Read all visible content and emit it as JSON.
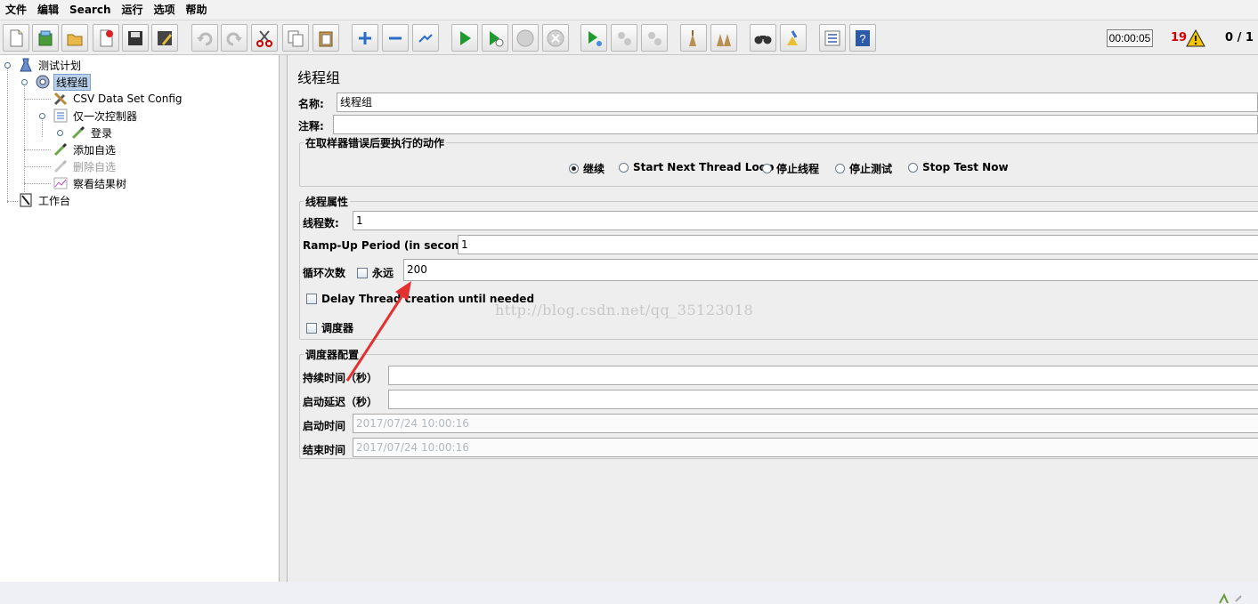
{
  "menu": [
    "文件",
    "编辑",
    "Search",
    "运行",
    "选项",
    "帮助"
  ],
  "toolbar": {
    "buttons": [
      {
        "name": "new-icon"
      },
      {
        "name": "templates-icon"
      },
      {
        "name": "open-icon"
      },
      {
        "name": "close-icon"
      },
      {
        "name": "save-icon"
      },
      {
        "name": "save-as-icon"
      },
      {
        "name": "undo-icon"
      },
      {
        "name": "redo-icon"
      },
      {
        "name": "cut-icon"
      },
      {
        "name": "copy-icon"
      },
      {
        "name": "paste-icon"
      },
      {
        "name": "expand-icon"
      },
      {
        "name": "collapse-icon"
      },
      {
        "name": "toggle-icon"
      },
      {
        "name": "start-icon"
      },
      {
        "name": "start-no-timers-icon"
      },
      {
        "name": "stop-icon"
      },
      {
        "name": "shutdown-icon"
      },
      {
        "name": "remote-start-icon"
      },
      {
        "name": "remote-stop-icon"
      },
      {
        "name": "remote-shutdown-icon"
      },
      {
        "name": "clear-icon"
      },
      {
        "name": "clear-all-icon"
      },
      {
        "name": "search-icon"
      },
      {
        "name": "reset-search-icon"
      },
      {
        "name": "function-helper-icon"
      },
      {
        "name": "help-icon"
      }
    ],
    "timer": "00:00:05",
    "error_count": "19",
    "thread_count": "0 / 1"
  },
  "tree": {
    "items": [
      {
        "label": "测试计划",
        "icon": "test-plan-icon"
      },
      {
        "label": "线程组",
        "icon": "thread-group-icon"
      },
      {
        "label": "CSV Data Set Config",
        "icon": "config-tools-icon"
      },
      {
        "label": "仅一次控制器",
        "icon": "controller-icon"
      },
      {
        "label": "登录",
        "icon": "sampler-pipette-icon"
      },
      {
        "label": "添加自选",
        "icon": "sampler-pipette-icon"
      },
      {
        "label": "删除自选",
        "icon": "sampler-pipette-disabled-icon"
      },
      {
        "label": "察看结果树",
        "icon": "results-tree-icon"
      },
      {
        "label": "工作台",
        "icon": "workbench-icon"
      }
    ]
  },
  "main": {
    "title": "线程组",
    "name_label": "名称:",
    "name_value": "线程组",
    "comment_label": "注释:",
    "comment_value": "",
    "error_action": {
      "title": "在取样器错误后要执行的动作",
      "options": [
        "继续",
        "Start Next Thread Loop",
        "停止线程",
        "停止测试",
        "Stop Test Now"
      ],
      "selected": "继续"
    },
    "thread_props": {
      "title": "线程属性",
      "threads_label": "线程数:",
      "threads_value": "1",
      "rampup_label": "Ramp-Up Period (in seconds):",
      "rampup_value": "1",
      "loop_label": "循环次数",
      "forever_label": "永远",
      "loop_value": "200",
      "delay_label": "Delay Thread creation until needed",
      "scheduler_label": "调度器"
    },
    "scheduler": {
      "title": "调度器配置",
      "duration_label": "持续时间（秒）",
      "duration_value": "",
      "delay_label": "启动延迟（秒）",
      "delay_value": "",
      "start_label": "启动时间",
      "start_value": "2017/07/24 10:00:16",
      "end_label": "结束时间",
      "end_value": "2017/07/24 10:00:16"
    },
    "watermark": "http://blog.csdn.net/qq_35123018"
  }
}
